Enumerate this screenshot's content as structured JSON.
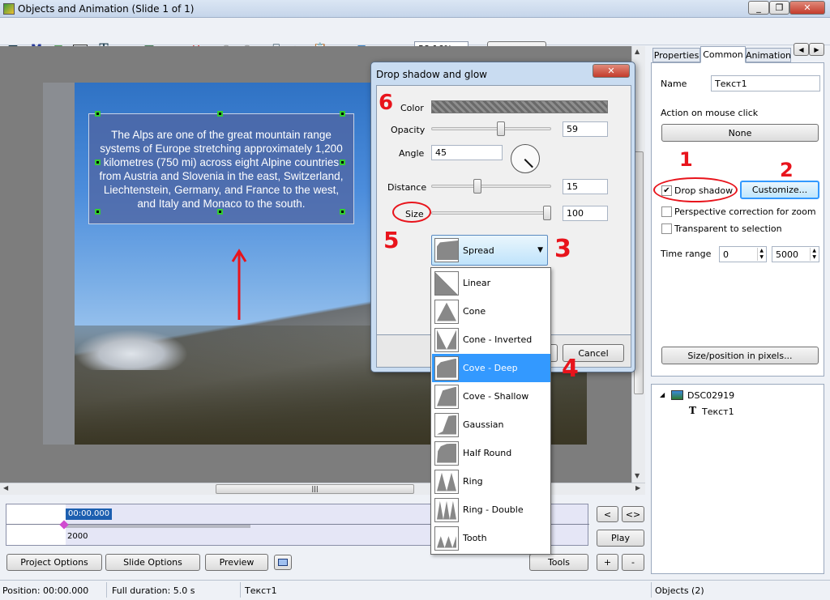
{
  "window": {
    "title": "Objects and Animation  (Slide 1 of 1)"
  },
  "toolbar": {
    "zoom": "58.16%",
    "close_label": "Close",
    "m_label": "M",
    "t_label": "T",
    "ok_label": "OK"
  },
  "slide": {
    "text": "The Alps are one of the great mountain range systems of Europe stretching approximately 1,200 kilometres (750 mi) across eight Alpine countries from Austria and Slovenia in the east, Switzerland, Liechtenstein, Germany, and France to the west, and Italy and Monaco to the south."
  },
  "dialog": {
    "title": "Drop shadow and glow",
    "color_label": "Color",
    "opacity_label": "Opacity",
    "opacity_value": "59",
    "opacity_level": 0.59,
    "angle_label": "Angle",
    "angle_value": "45",
    "distance_label": "Distance",
    "distance_value": "15",
    "distance_level": 0.38,
    "size_label": "Size",
    "size_value": "100",
    "size_level": 1.0,
    "cancel_label": "Cancel"
  },
  "dropdown": {
    "selected": "Spread",
    "options": [
      "Linear",
      "Cone",
      "Cone - Inverted",
      "Cove - Deep",
      "Cove - Shallow",
      "Gaussian",
      "Half Round",
      "Ring",
      "Ring - Double",
      "Tooth"
    ],
    "highlighted": "Cove - Deep"
  },
  "panel": {
    "tabs": [
      "Properties",
      "Common",
      "Animation"
    ],
    "active_tab": "Common",
    "name_label": "Name",
    "name_value": "Текст1",
    "action_label": "Action on mouse click",
    "none_label": "None",
    "drop_shadow_label": "Drop shadow",
    "customize_label": "Customize...",
    "perspective_label": "Perspective correction for zoom",
    "transparent_label": "Transparent to selection",
    "time_range_label": "Time range",
    "time_start": "0",
    "time_end": "5000",
    "sizepos_label": "Size/position in pixels..."
  },
  "tree": {
    "root": "DSC02919",
    "child": "Текст1"
  },
  "timeline": {
    "time": "00:00.000",
    "mark": "2000",
    "btn_back": "<",
    "btn_fwd": "<>",
    "play_label": "Play",
    "plus": "+",
    "minus": "-"
  },
  "bottom": {
    "project_options": "Project Options",
    "slide_options": "Slide Options",
    "preview": "Preview",
    "tools": "Tools"
  },
  "status": {
    "position": "Position:  00:00.000",
    "duration": "Full duration:  5.0 s",
    "object": "Текст1",
    "objects": "Objects (2)"
  },
  "annotations": {
    "a1": "1",
    "a2": "2",
    "a3": "3",
    "a4": "4",
    "a5": "5",
    "a6": "6"
  },
  "colors": {
    "accent": "#3399ff",
    "annotation": "#e8141c",
    "title_close": "#c43c2c"
  }
}
